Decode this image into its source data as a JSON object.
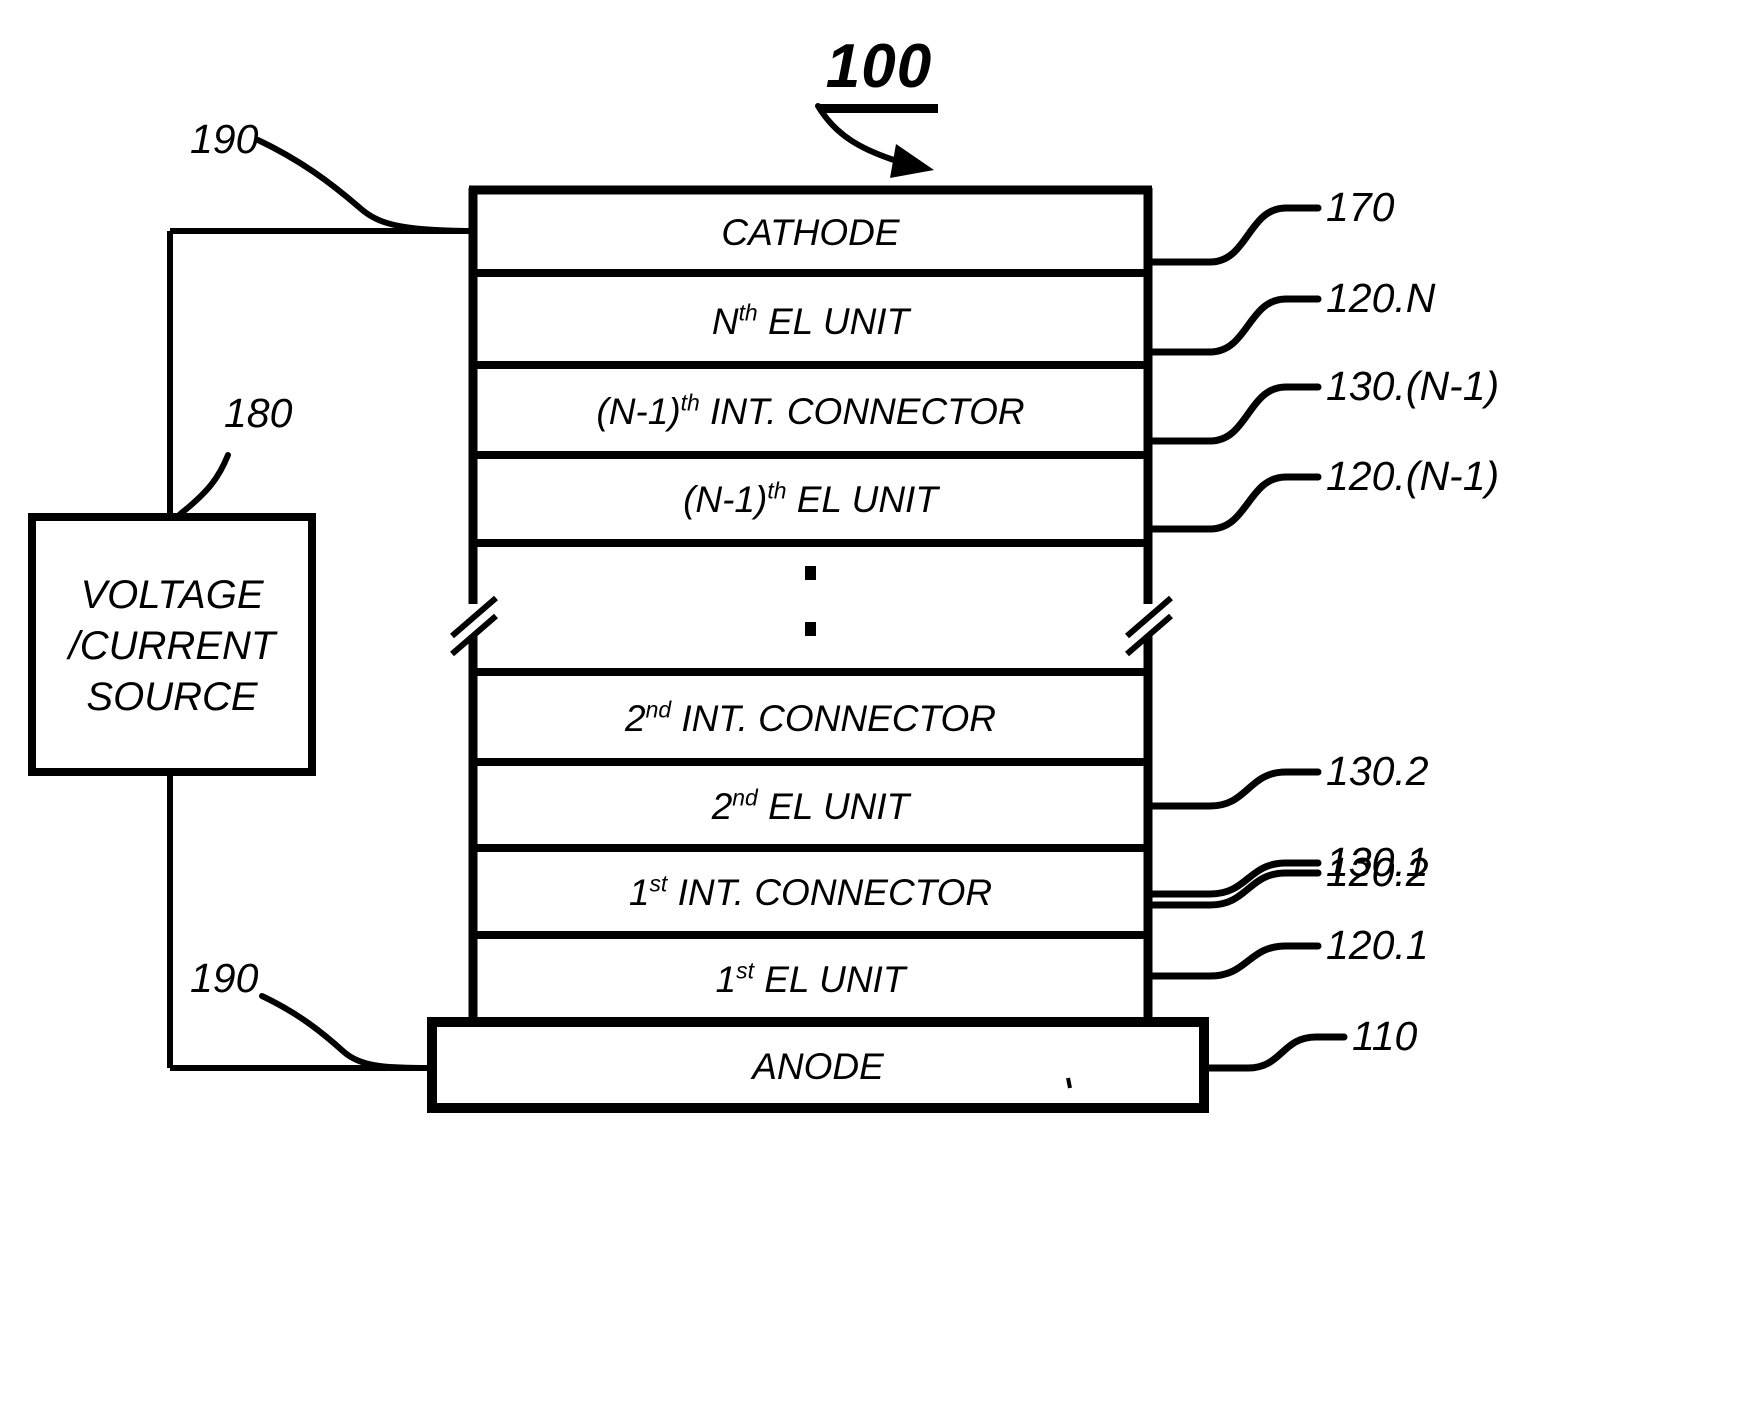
{
  "figure": {
    "number": "100",
    "type": "stacked-electroluminescent-device-diagram"
  },
  "source_box": {
    "name": "voltage-current-source",
    "lines": [
      "VOLTAGE",
      "/CURRENT",
      "SOURCE"
    ],
    "ref": "180"
  },
  "stack": {
    "layers": [
      {
        "id": "cathode",
        "text": "CATHODE",
        "ordinal": "",
        "suffix": "",
        "ref": "170"
      },
      {
        "id": "el-unit-n",
        "text": "N<sup>th</sup> EL UNIT",
        "ordinal": "N",
        "suffix": "th EL UNIT",
        "ref": "120.N"
      },
      {
        "id": "int-conn-n-1",
        "text": "(N-1)<sup>th</sup> INT. CONNECTOR",
        "ordinal": "(N-1)",
        "suffix": "th INT. CONNECTOR",
        "ref": "130.(N-1)"
      },
      {
        "id": "el-unit-n-1",
        "text": "(N-1)<sup>th</sup> EL UNIT",
        "ordinal": "(N-1)",
        "suffix": "th EL UNIT",
        "ref": "120.(N-1)"
      },
      {
        "id": "ellipsis-gap",
        "text": "",
        "ordinal": "",
        "suffix": "",
        "ref": ""
      },
      {
        "id": "int-conn-2",
        "text": "2<sup>nd</sup> INT. CONNECTOR",
        "ordinal": "2",
        "suffix": "nd INT. CONNECTOR",
        "ref": "130.2"
      },
      {
        "id": "el-unit-2",
        "text": "2<sup>nd</sup> EL UNIT",
        "ordinal": "2",
        "suffix": "nd EL UNIT",
        "ref": "120.2"
      },
      {
        "id": "int-conn-1",
        "text": "1<sup>st</sup> INT. CONNECTOR",
        "ordinal": "1",
        "suffix": "st INT. CONNECTOR",
        "ref": "130.1"
      },
      {
        "id": "el-unit-1",
        "text": "1<sup>st</sup> EL UNIT",
        "ordinal": "1",
        "suffix": "st EL UNIT",
        "ref": "120.1"
      },
      {
        "id": "anode",
        "text": "ANODE",
        "ordinal": "",
        "suffix": "",
        "ref": "110"
      }
    ],
    "ellipsis_symbol": "vertical-dots",
    "break_symbol": "double-slash-break"
  },
  "layer_labels": {
    "cathode": "CATHODE",
    "el_unit_n_ordinal": "N",
    "el_unit_n_sup": "th",
    "el_unit_n_rest": " EL UNIT",
    "int_conn_n1_ordinal": "(N-1)",
    "int_conn_n1_sup": "th",
    "int_conn_n1_rest": " INT. CONNECTOR",
    "el_unit_n1_ordinal": "(N-1)",
    "el_unit_n1_sup": "th",
    "el_unit_n1_rest": " EL UNIT",
    "int_conn_2_ordinal": "2",
    "int_conn_2_sup": "nd",
    "int_conn_2_rest": " INT. CONNECTOR",
    "el_unit_2_ordinal": "2",
    "el_unit_2_sup": "nd",
    "el_unit_2_rest": " EL UNIT",
    "int_conn_1_ordinal": "1",
    "int_conn_1_sup": "st",
    "int_conn_1_rest": " INT. CONNECTOR",
    "el_unit_1_ordinal": "1",
    "el_unit_1_sup": "st",
    "el_unit_1_rest": " EL UNIT",
    "anode": "ANODE"
  },
  "reference_numerals": {
    "cathode": "170",
    "el_unit_n": "120.N",
    "int_conn_n1": "130.(N-1)",
    "el_unit_n1": "120.(N-1)",
    "int_conn_2": "130.2",
    "el_unit_2": "120.2",
    "int_conn_1": "130.1",
    "el_unit_1": "120.1",
    "anode": "110",
    "source": "180",
    "wire_top": "190",
    "wire_bottom": "190"
  },
  "colors": {
    "ink": "#000000",
    "background": "#ffffff"
  }
}
